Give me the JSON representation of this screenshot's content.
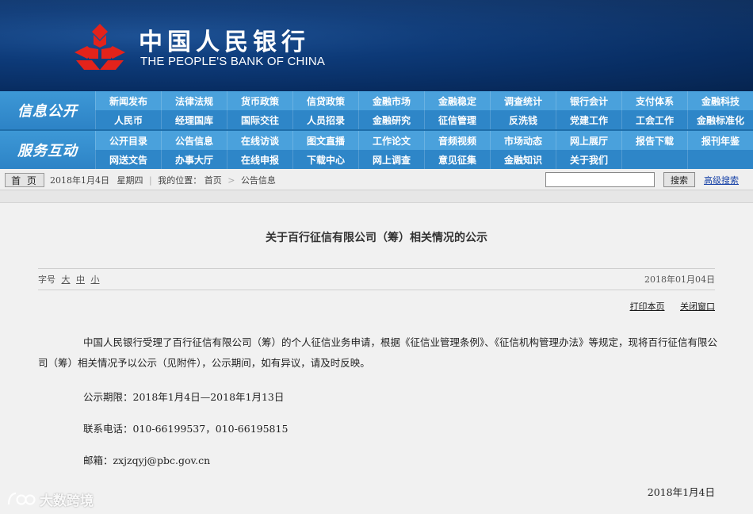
{
  "header": {
    "brand_cn": "中国人民银行",
    "brand_en": "THE PEOPLE'S BANK OF CHINA",
    "logo_color": "#e3231b"
  },
  "nav": {
    "section1_title": "信息公开",
    "section2_title": "服务互动",
    "row1": [
      "新闻发布",
      "法律法规",
      "货币政策",
      "信贷政策",
      "金融市场",
      "金融稳定",
      "调查统计",
      "银行会计",
      "支付体系",
      "金融科技",
      "人民币",
      "经理国库",
      "国际交往",
      "人员招录",
      "金融研究",
      "征信管理",
      "反洗钱",
      "党建工作",
      "工会工作",
      "金融标准化"
    ],
    "row2": [
      "公开目录",
      "公告信息",
      "在线访谈",
      "图文直播",
      "工作论文",
      "音频视频",
      "市场动态",
      "网上展厅",
      "报告下载",
      "报刊年鉴",
      "网送文告",
      "办事大厅",
      "在线申报",
      "下载中心",
      "网上调查",
      "意见征集",
      "金融知识",
      "关于我们",
      "",
      ""
    ]
  },
  "toolbar": {
    "home_label": "首 页",
    "date": "2018年1月4日",
    "weekday": "星期四",
    "location_label": "我的位置：",
    "crumb_home": "首页",
    "crumb_sep": ">",
    "crumb_current": "公告信息",
    "search_value": "",
    "search_button": "搜索",
    "advanced_search": "高级搜索"
  },
  "article": {
    "title": "关于百行征信有限公司（筹）相关情况的公示",
    "font_size_label": "字号",
    "font_size_options": [
      "大",
      "中",
      "小"
    ],
    "publish_date": "2018年01月04日",
    "print_label": "打印本页",
    "close_label": "关闭窗口",
    "paragraph1": "中国人民银行受理了百行征信有限公司（筹）的个人征信业务申请，根据《征信业管理条例》、《征信机构管理办法》等规定，现将百行征信有限公司（筹）相关情况予以公示（见附件），公示期间，如有异议，请及时反映。",
    "period": "公示期限：2018年1月4日—2018年1月13日",
    "phone": "联系电话：010-66199537，010-66195815",
    "email": "邮箱：zxjzqyj@pbc.gov.cn",
    "sign_date": "2018年1月4日"
  },
  "watermark": {
    "text": "大数跨境",
    "icon": "brand-logo-icon"
  }
}
